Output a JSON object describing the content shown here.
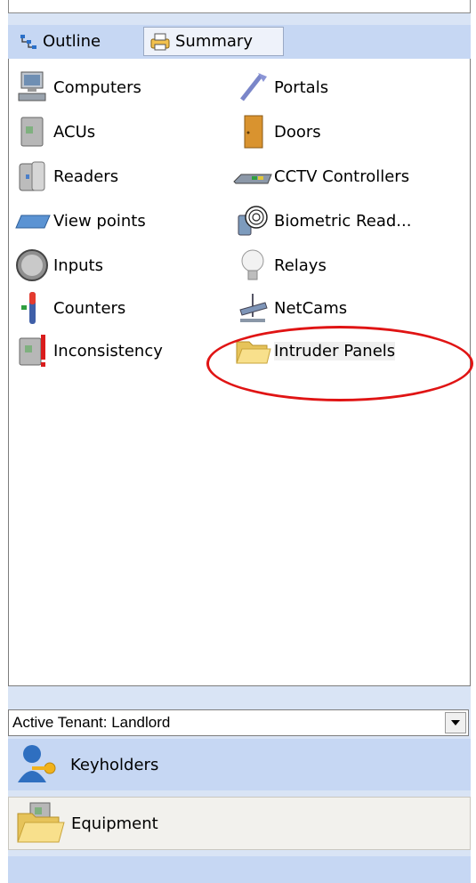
{
  "tabs": {
    "outline": "Outline",
    "summary": "Summary"
  },
  "items": {
    "computers": "Computers",
    "portals": "Portals",
    "acus": "ACUs",
    "doors": "Doors",
    "readers": "Readers",
    "cctv": "CCTV Controllers",
    "viewpoints": "View points",
    "biometric": "Biometric Read...",
    "inputs": "Inputs",
    "relays": "Relays",
    "counters": "Counters",
    "netcams": "NetCams",
    "inconsistency": "Inconsistency",
    "intruder": "Intruder Panels"
  },
  "tenant": {
    "label": "Active Tenant: Landlord"
  },
  "nav": {
    "keyholders": "Keyholders",
    "equipment": "Equipment"
  },
  "colors": {
    "highlight_circle": "#e01414",
    "tab_strip": "#c6d7f3"
  }
}
